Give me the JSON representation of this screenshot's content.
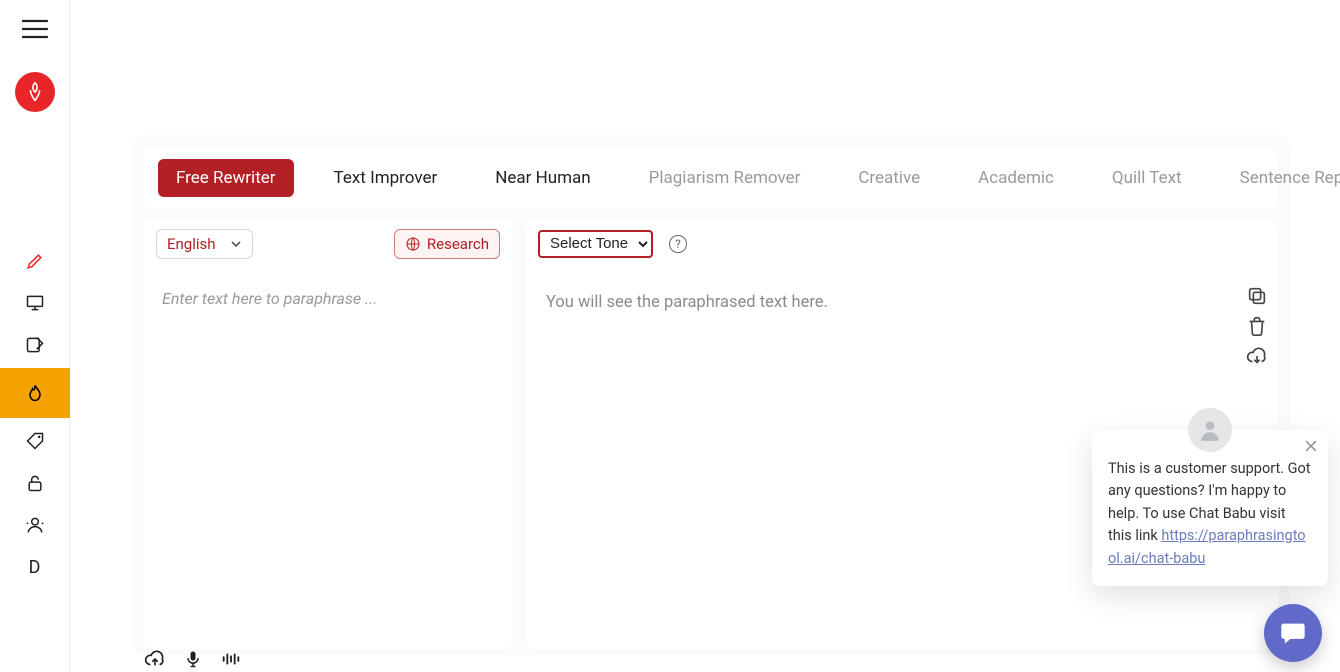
{
  "sidebar": {
    "letter_item": "D"
  },
  "tabs": [
    {
      "label": "Free Rewriter",
      "state": "primary"
    },
    {
      "label": "Text Improver",
      "state": "normal"
    },
    {
      "label": "Near Human",
      "state": "normal"
    },
    {
      "label": "Plagiarism Remover",
      "state": "muted"
    },
    {
      "label": "Creative",
      "state": "muted"
    },
    {
      "label": "Academic",
      "state": "muted"
    },
    {
      "label": "Quill Text",
      "state": "muted"
    },
    {
      "label": "Sentence Rephraser",
      "state": "muted"
    }
  ],
  "left_panel": {
    "language": "English",
    "research_label": "Research",
    "input_placeholder": "Enter text here to paraphrase ..."
  },
  "right_panel": {
    "tone_selected": "Select Tone",
    "output_placeholder": "You will see the paraphrased text here."
  },
  "chat": {
    "message": "This is a customer support. Got any questions? I'm happy to help. To use Chat Babu visit this link",
    "link_text": "https://paraphrasingtool.ai/chat-babu"
  },
  "colors": {
    "brand_red": "#b21f24",
    "logo_red": "#e8262a",
    "sidebar_active": "#f5a203",
    "chat_launcher": "#6169c9"
  }
}
